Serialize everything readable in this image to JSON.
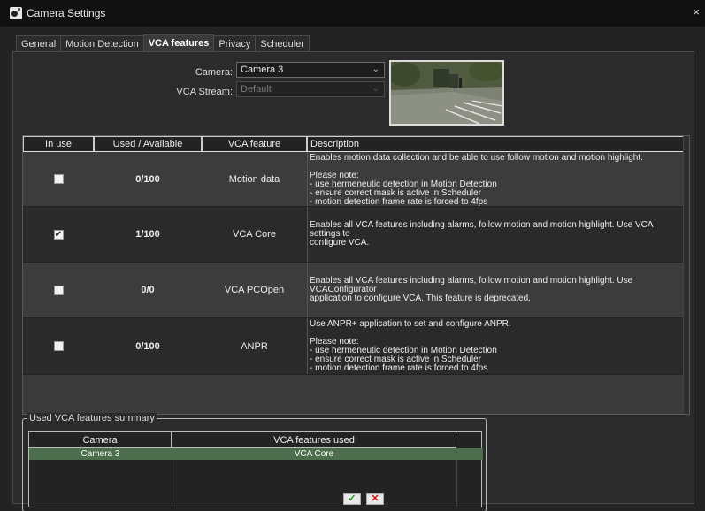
{
  "window": {
    "title": "Camera Settings",
    "close_glyph": "×",
    "icon": "camera-settings-icon"
  },
  "tabs": [
    {
      "label": "General",
      "active": false
    },
    {
      "label": "Motion Detection",
      "active": false
    },
    {
      "label": "VCA features",
      "active": true
    },
    {
      "label": "Privacy",
      "active": false
    },
    {
      "label": "Scheduler",
      "active": false
    }
  ],
  "form": {
    "camera_label": "Camera:",
    "camera_value": "Camera 3",
    "stream_label": "VCA Stream:",
    "stream_value": "Default"
  },
  "features_table": {
    "headers": [
      "In use",
      "Used  / Available",
      "VCA feature",
      "Description"
    ],
    "rows": [
      {
        "in_use": false,
        "used": "0/100",
        "feature": "Motion data",
        "description": "Enables motion data collection and be able to use follow motion and motion highlight.\n\nPlease note:\n- use hermeneutic detection in Motion Detection\n- ensure correct mask is active in Scheduler\n- motion detection frame rate is forced to 4fps"
      },
      {
        "in_use": true,
        "used": "1/100",
        "feature": "VCA Core",
        "description": "Enables all VCA features including alarms, follow motion and motion highlight. Use VCA settings to\nconfigure VCA."
      },
      {
        "in_use": false,
        "used": "0/0",
        "feature": "VCA PCOpen",
        "description": "Enables all VCA features including alarms, follow motion and motion highlight. Use VCAConfigurator\napplication to configure VCA. This feature is deprecated."
      },
      {
        "in_use": false,
        "used": "0/100",
        "feature": "ANPR",
        "description": "Use ANPR+ application to set and configure ANPR.\n\nPlease note:\n- use hermeneutic detection in Motion Detection\n- ensure correct mask is active in Scheduler\n- motion detection frame rate is forced to 4fps"
      }
    ]
  },
  "summary": {
    "legend": "Used VCA features summary",
    "headers": [
      "Camera",
      "VCA features used"
    ],
    "rows": [
      {
        "camera": "Camera 3",
        "features": "VCA Core"
      }
    ]
  },
  "buttons": {
    "ok": "✓",
    "cancel": "✕"
  },
  "colors": {
    "selected_row": "#4d6e4d",
    "ok_icon": "#1a9a1a",
    "cancel_icon": "#d41010"
  }
}
